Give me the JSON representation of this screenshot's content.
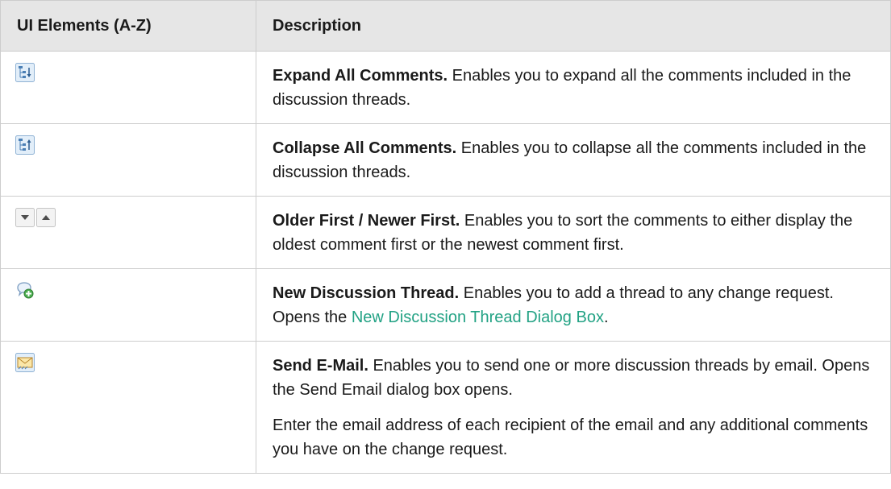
{
  "header": {
    "col1": "UI Elements (A-Z)",
    "col2": "Description"
  },
  "rows": [
    {
      "icon": "expand-all-comments-icon",
      "title": "Expand All Comments.",
      "text": " Enables you to expand all the comments included in the discussion threads."
    },
    {
      "icon": "collapse-all-comments-icon",
      "title": "Collapse All Comments.",
      "text": " Enables you to collapse all the comments included in the discussion threads."
    },
    {
      "icons": [
        "sort-older-first-icon",
        "sort-newer-first-icon"
      ],
      "title": "Older First / Newer First.",
      "text": " Enables you to sort the comments to either display the oldest comment first or the newest comment first."
    },
    {
      "icon": "new-discussion-thread-icon",
      "title": "New Discussion Thread.",
      "text": " Enables you to add a thread to any change request. Opens the ",
      "link": "New Discussion Thread Dialog Box",
      "text_after": "."
    },
    {
      "icon": "send-email-icon",
      "title": "Send E-Mail.",
      "text": " Enables you to send one or more discussion threads by email. Opens the Send Email dialog box opens.",
      "para2": "Enter the email address of each recipient of the email and any additional comments you have on the change request."
    }
  ],
  "colors": {
    "header_bg": "#e6e6e6",
    "border": "#cdcdcd",
    "link": "#22a284"
  }
}
